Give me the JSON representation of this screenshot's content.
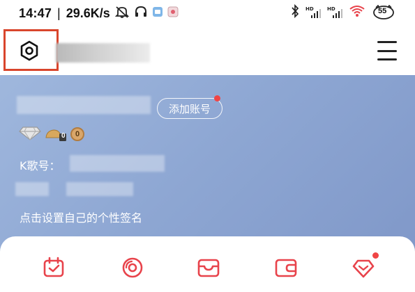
{
  "status_bar": {
    "time": "14:47",
    "separator": "|",
    "net_speed": "29.6K/s",
    "hd_label_1": "HD",
    "hd_label_2": "HD",
    "battery": "55"
  },
  "header": {
    "settings_icon": "gear-hex-icon",
    "menu_icon": "hamburger-icon"
  },
  "profile": {
    "add_account_label": "添加账号",
    "level_zero": "0",
    "coin_zero": "0",
    "kge_label": "K歌号：",
    "signature_placeholder": "点击设置自己的个性签名"
  },
  "quick_actions": [
    {
      "icon": "calendar-check-icon"
    },
    {
      "icon": "vinyl-disc-icon"
    },
    {
      "icon": "inbox-tray-icon"
    },
    {
      "icon": "wallet-icon"
    },
    {
      "icon": "heart-diamond-icon"
    }
  ],
  "colors": {
    "accent": "#e8434b",
    "highlight_box": "#d9452c",
    "banner_start": "#9fb7dd",
    "banner_end": "#7f97c8"
  }
}
